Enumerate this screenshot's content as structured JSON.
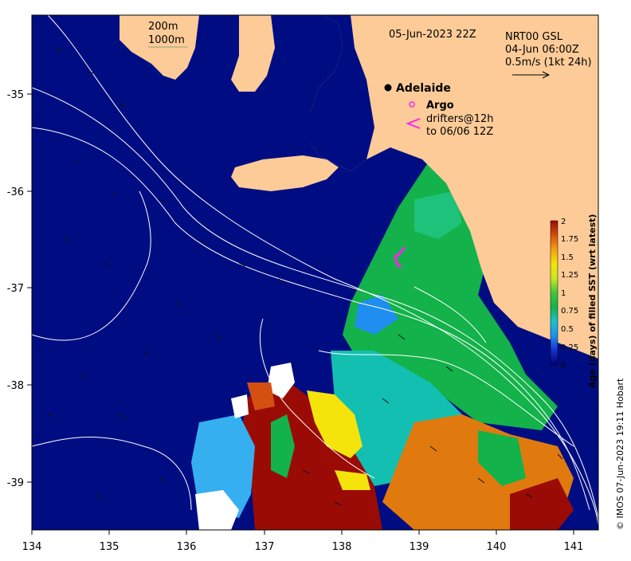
{
  "map": {
    "date_label": "05-Jun-2023 22Z",
    "product": {
      "line1": "NRT00 GSL",
      "line2": "04-Jun 06:00Z",
      "line3": "0.5m/s (1kt 24h)"
    },
    "isobaths": {
      "shallow": "200m",
      "deep": "1000m"
    },
    "city": "Adelaide",
    "legend": {
      "argo": "Argo",
      "drifters_line1": "drifters@12h",
      "drifters_line2": "to 06/06 12Z"
    },
    "credit": "© IMOS 07-Jun-2023 19:11 Hobart",
    "axes": {
      "x_ticks": [
        "134",
        "135",
        "136",
        "137",
        "138",
        "139",
        "140",
        "141"
      ],
      "y_ticks": [
        "-35",
        "-36",
        "-37",
        "-38",
        "-39"
      ]
    },
    "colorbar": {
      "label": "Age (days) of filled SST (wrt latest)",
      "ticks": [
        "0",
        "0.25",
        "0.5",
        "0.75",
        "1",
        "1.25",
        "1.5",
        "1.75",
        "2"
      ]
    },
    "colors": {
      "ocean": "#000d82",
      "land": "#fdcb98",
      "age_fresh_green": "#13b24a",
      "age_cyan": "#13bfb0",
      "age_orange": "#e07a0e",
      "age_old_darkred": "#9b0b05",
      "age_yellow": "#f4e40c",
      "drifter": "#ff22ee"
    }
  }
}
